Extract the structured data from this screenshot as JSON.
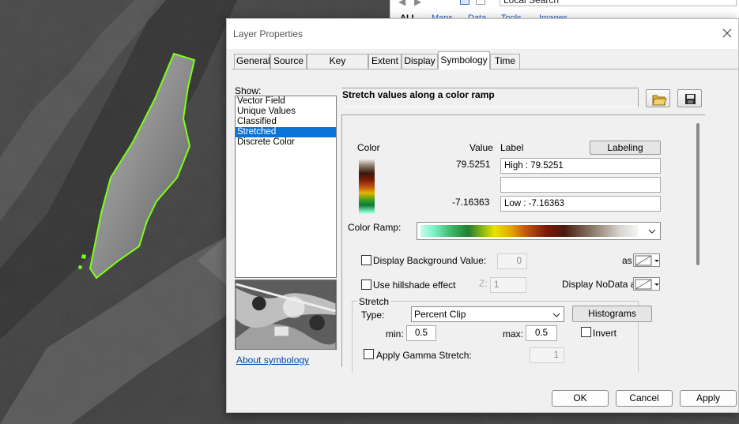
{
  "catalog": {
    "search_value": "Local Search",
    "tabs": [
      "ALL",
      "Maps",
      "Data",
      "Tools",
      "Images"
    ]
  },
  "dialog": {
    "title": "Layer Properties",
    "tabs": [
      "General",
      "Source",
      "Key Metadata",
      "Extent",
      "Display",
      "Symbology",
      "Time"
    ],
    "active_tab": "Symbology",
    "show_label": "Show:",
    "show_items": [
      "Vector Field",
      "Unique Values",
      "Classified",
      "Stretched",
      "Discrete Color"
    ],
    "selected_show_item": "Stretched",
    "about_link": "About symbology",
    "heading": "Stretch values along a color ramp",
    "icons": {
      "open": "folder-open-icon",
      "save": "floppy-save-icon",
      "close": "close-icon"
    },
    "legend": {
      "color_header": "Color",
      "value_header": "Value",
      "label_header": "Label",
      "labeling_button": "Labeling",
      "high_value": "79.5251",
      "high_label": "High : 79.5251",
      "mid_label": "",
      "low_value": "-7.16363",
      "low_label": "Low : -7.16363"
    },
    "color_ramp_label": "Color Ramp:",
    "background": {
      "label": "Display Background Value:",
      "value": "0",
      "as_label": "as",
      "checked": false
    },
    "hillshade": {
      "label": "Use hillshade effect",
      "z_label": "Z:",
      "z_value": "1",
      "checked": false
    },
    "nodata_label": "Display NoData as",
    "stretch": {
      "group_title": "Stretch",
      "type_label": "Type:",
      "type_value": "Percent Clip",
      "histograms_button": "Histograms",
      "min_label": "min:",
      "min_value": "0.5",
      "max_label": "max:",
      "max_value": "0.5",
      "invert_label": "Invert",
      "invert_checked": false,
      "gamma_label": "Apply Gamma Stretch:",
      "gamma_value": "1",
      "gamma_checked": false
    },
    "footer": {
      "ok": "OK",
      "cancel": "Cancel",
      "apply": "Apply"
    }
  },
  "colors": {
    "selection": "#0a74d6",
    "outline": "#7cff1a",
    "link": "#0645ad"
  }
}
